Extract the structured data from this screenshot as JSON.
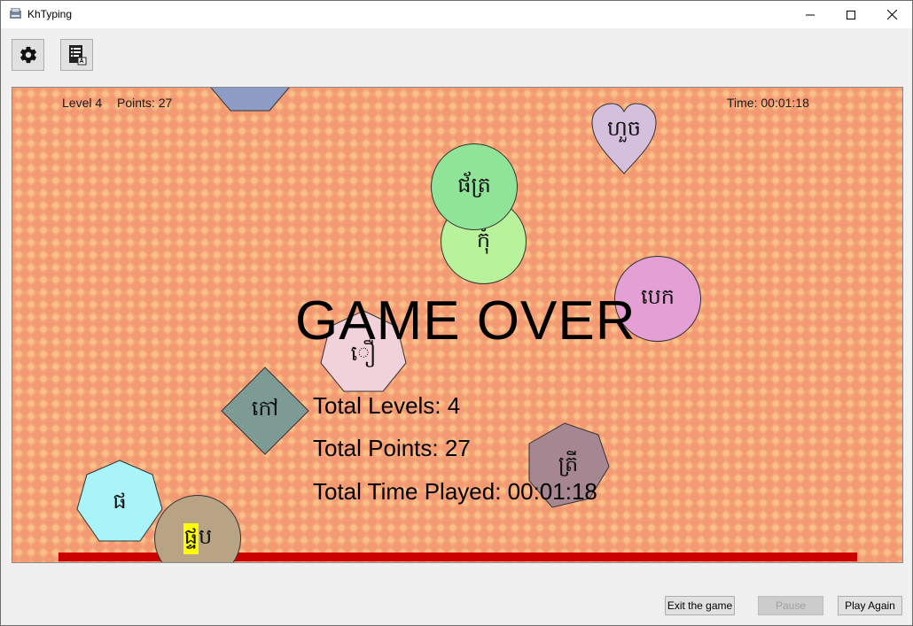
{
  "window": {
    "title": "KhTyping"
  },
  "toolbar": {
    "settings_icon": "gear-icon",
    "report_icon": "report-icon"
  },
  "hud": {
    "level": "Level 4",
    "points": "Points: 27",
    "time": "Time: 00:01:18"
  },
  "game_over": {
    "title": "GAME OVER",
    "total_levels": "Total Levels: 4",
    "total_points": "Total Points: 27",
    "total_time": "Total Time Played: 00:01:18"
  },
  "words": {
    "heart": "ហួច",
    "green_dark": "ផ័ត្រ",
    "green_light": "កុំ",
    "pink_circle": "បេក",
    "pink_heptagon": "ឿ",
    "diamond": "កៅ",
    "mauve_heptagon": "ត្រី",
    "cyan_heptagon": "ផ",
    "tan_circle_hl": "ផ្ទ",
    "tan_circle_rest": "ប"
  },
  "colors": {
    "red_bar": "#cc0000",
    "highlight": "#ffff00"
  },
  "buttons": {
    "exit": "Exit the game",
    "pause": "Pause",
    "play_again": "Play Again"
  }
}
